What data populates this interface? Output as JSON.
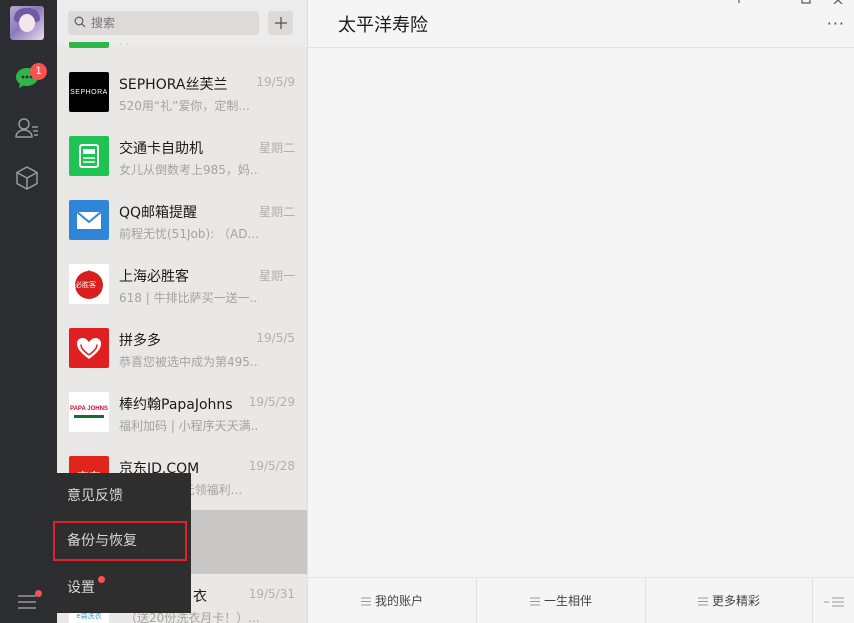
{
  "nav": {
    "badge_count": "1"
  },
  "search": {
    "placeholder": "搜索"
  },
  "chats": [
    {
      "name": "SEPHORA丝芙兰",
      "time": "19/5/9",
      "preview": "520用“礼”爱你，定制...",
      "logo_text": "SEPHORA"
    },
    {
      "name": "交通卡自助机",
      "time": "星期二",
      "preview": "女儿从倒数考上985，妈..."
    },
    {
      "name": "QQ邮箱提醒",
      "time": "星期二",
      "preview": "前程无忧(51Job): （AD..."
    },
    {
      "name": "上海必胜客",
      "time": "星期一",
      "preview": "618 | 牛排比萨买一送一...",
      "logo_text": "必胜客"
    },
    {
      "name": "拼多多",
      "time": "19/5/5",
      "preview": "恭喜您被选中成为第495..."
    },
    {
      "name": "棒约翰PapaJohns",
      "time": "19/5/29",
      "preview": "福利加码 | 小程序天天满...",
      "logo_text": "PAPA JOHNS"
    },
    {
      "name": "京东JD.COM",
      "time": "19/5/28",
      "preview": "1元领福利...",
      "logo_text": "京东"
    },
    {
      "name": "衣",
      "time": "19/5/31",
      "preview": "（送20份洗衣月卡！）...",
      "logo_text": "e袋洗衣"
    }
  ],
  "popup": {
    "feedback": "意见反馈",
    "backup": "备份与恢复",
    "settings": "设置"
  },
  "main": {
    "title": "太平洋寿险",
    "more": "···",
    "menu": [
      "我的账户",
      "一生相伴",
      "更多精彩"
    ]
  },
  "colors": {
    "accent_green": "#2fb54a",
    "badge_red": "#fa5151",
    "highlight_border": "#e0202a"
  }
}
